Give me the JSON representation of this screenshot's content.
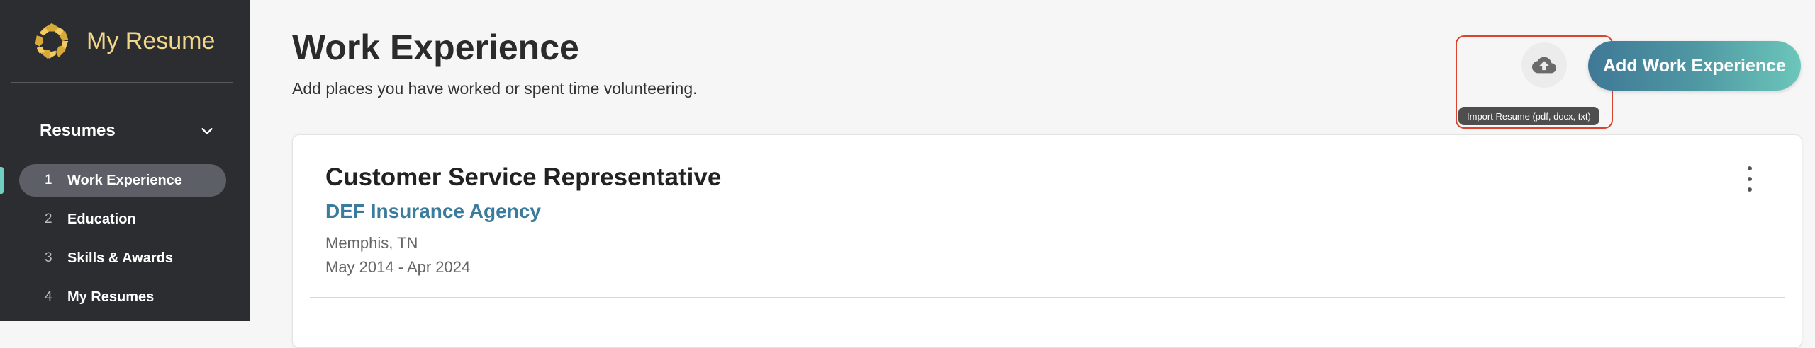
{
  "sidebar": {
    "app_name": "My Resume",
    "section_title": "Resumes",
    "items": [
      {
        "num": "1",
        "label": "Work Experience"
      },
      {
        "num": "2",
        "label": "Education"
      },
      {
        "num": "3",
        "label": "Skills & Awards"
      },
      {
        "num": "4",
        "label": "My Resumes"
      }
    ]
  },
  "header": {
    "title": "Work Experience",
    "subtitle": "Add places you have worked or spent time volunteering.",
    "import_tooltip": "Import Resume (pdf, docx, txt)",
    "import_icon": "cloud-upload-icon",
    "add_label": "Add Work Experience"
  },
  "experience": [
    {
      "title": "Customer Service Representative",
      "company": "DEF Insurance Agency",
      "location": "Memphis, TN",
      "dates": "May 2014 - Apr 2024"
    }
  ],
  "colors": {
    "sidebar_bg": "#2b2d31",
    "brand_gold": "#f2d78a",
    "accent_teal": "#6fd0c2",
    "company_link": "#3b7c9e",
    "highlight_border": "#d9452f"
  }
}
